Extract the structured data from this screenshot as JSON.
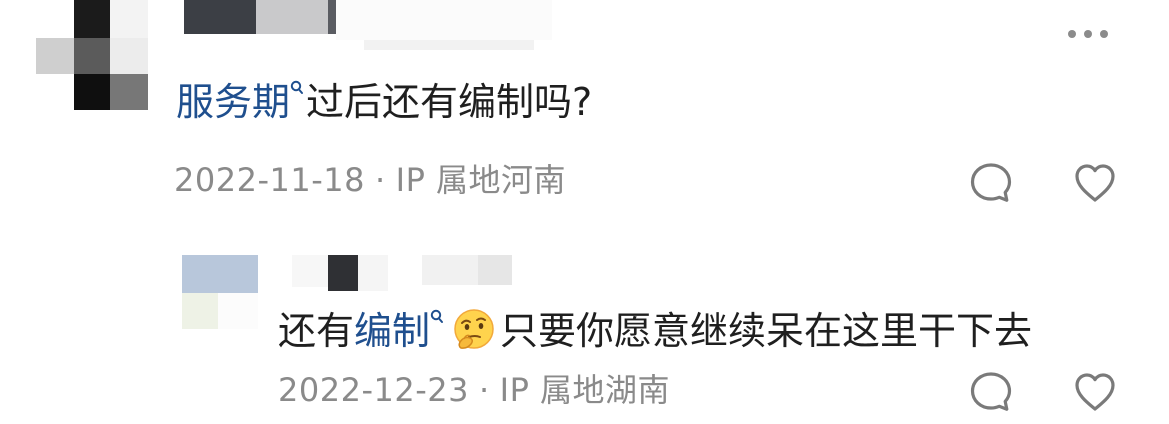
{
  "comments": [
    {
      "name_hidden": true,
      "text_link": "服务期",
      "text_rest": "过后还有编制吗?",
      "date": "2022-11-18",
      "separator": "·",
      "location": "IP 属地河南",
      "icons": {
        "reply": "reply-bubble-icon",
        "like": "heart-icon",
        "more": "more-dots-icon"
      }
    },
    {
      "name_hidden": true,
      "text_prefix": "还有",
      "text_link": "编制",
      "text_rest": "只要你愿意继续呆在这里干下去",
      "emoji": "thinking-face-emoji",
      "date": "2022-12-23",
      "separator": "·",
      "location": "IP 属地湖南",
      "icons": {
        "reply": "reply-bubble-icon",
        "like": "heart-icon"
      }
    }
  ],
  "colors": {
    "link": "#1f4f8e",
    "meta": "#8a8a8a",
    "text": "#1f1f1f",
    "icon": "#7a7a7a"
  }
}
